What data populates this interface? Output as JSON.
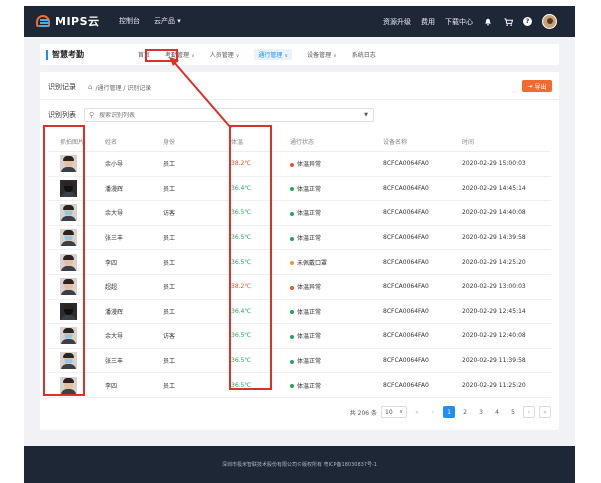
{
  "topbar": {
    "brand": "MIPS云",
    "nav": [
      "控制台",
      "云产品 ▾"
    ],
    "right_links": [
      "资源升级",
      "费用",
      "下载中心"
    ],
    "icons": [
      "bell-icon",
      "cart-icon",
      "help-icon",
      "avatar"
    ]
  },
  "subnav": {
    "title": "智慧考勤",
    "items": [
      {
        "label": "首页",
        "chevron": ""
      },
      {
        "label": "考勤管理",
        "chevron": "∨"
      },
      {
        "label": "人员管理",
        "chevron": "∨"
      },
      {
        "label": "通行管理",
        "chevron": "∨",
        "active": true
      },
      {
        "label": "设备管理",
        "chevron": "∨"
      },
      {
        "label": "系统日志",
        "chevron": ""
      }
    ]
  },
  "page": {
    "title": "识别记录",
    "breadcrumb": "/通行管理 / 识别记录",
    "export_label": "导出",
    "filter_label": "识别列表",
    "search_placeholder": "搜索识别列表"
  },
  "table": {
    "headers": [
      "抓拍图片",
      "姓名",
      "身份",
      "体温",
      "通行状态",
      "设备名称",
      "时间"
    ],
    "rows": [
      {
        "name": "余小导",
        "role": "员工",
        "temp": "38.2℃",
        "temp_state": "high",
        "status": "体温异常",
        "status_color": "red",
        "device": "8CFCA0064FA0",
        "time": "2020-02-29 15:00:03",
        "face": "plain"
      },
      {
        "name": "潘漫辉",
        "role": "员工",
        "temp": "36.4℃",
        "temp_state": "ok",
        "status": "体温正常",
        "status_color": "green",
        "device": "8CFCA0064FA0",
        "time": "2020-02-29 14:45:14",
        "face": "dark"
      },
      {
        "name": "余大导",
        "role": "访客",
        "temp": "36.5℃",
        "temp_state": "ok",
        "status": "体温正常",
        "status_color": "green",
        "device": "8CFCA0064FA0",
        "time": "2020-02-29 14:40:08",
        "face": "mask"
      },
      {
        "name": "张三丰",
        "role": "员工",
        "temp": "36.5℃",
        "temp_state": "ok",
        "status": "体温正常",
        "status_color": "green",
        "device": "8CFCA0064FA0",
        "time": "2020-02-29 14:39:58",
        "face": "mask"
      },
      {
        "name": "李四",
        "role": "员工",
        "temp": "36.5℃",
        "temp_state": "ok",
        "status": "未佩戴口罩",
        "status_color": "orange",
        "device": "8CFCA0064FA0",
        "time": "2020-02-29 14:25:20",
        "face": "plain"
      },
      {
        "name": "超超",
        "role": "员工",
        "temp": "38.2℃",
        "temp_state": "high",
        "status": "体温异常",
        "status_color": "red",
        "device": "8CFCA0064FA0",
        "time": "2020-02-29 13:00:03",
        "face": "plain"
      },
      {
        "name": "潘漫辉",
        "role": "员工",
        "temp": "36.4℃",
        "temp_state": "ok",
        "status": "体温正常",
        "status_color": "green",
        "device": "8CFCA0064FA0",
        "time": "2020-02-29 12:45:14",
        "face": "dark"
      },
      {
        "name": "余大导",
        "role": "访客",
        "temp": "36.5℃",
        "temp_state": "ok",
        "status": "体温正常",
        "status_color": "green",
        "device": "8CFCA0064FA0",
        "time": "2020-02-29 12:40:08",
        "face": "mask"
      },
      {
        "name": "张三丰",
        "role": "员工",
        "temp": "36.5℃",
        "temp_state": "ok",
        "status": "体温正常",
        "status_color": "green",
        "device": "8CFCA0064FA0",
        "time": "2020-02-29 11:39:58",
        "face": "mask"
      },
      {
        "name": "李四",
        "role": "员工",
        "temp": "36.5℃",
        "temp_state": "ok",
        "status": "体温正常",
        "status_color": "green",
        "device": "8CFCA0064FA0",
        "time": "2020-02-29 11:25:20",
        "face": "plain"
      }
    ]
  },
  "pagination": {
    "total": "共 206 条",
    "page_size": "10",
    "prev_prev": "«",
    "prev": "‹",
    "pages": [
      "1",
      "2",
      "3",
      "4",
      "5"
    ],
    "current": "1",
    "next": "›",
    "next_next": "»"
  },
  "footer": {
    "text": "深圳市极米智联技术股份有限公司©版权所有 粤ICP备18030837号-1"
  },
  "colors": {
    "accent": "#1f8ff5",
    "export": "#f26a2e",
    "high_temp": "#e8522f",
    "normal_temp": "#27a55c",
    "annotation": "#d8322c",
    "topbar": "#1e2735"
  }
}
